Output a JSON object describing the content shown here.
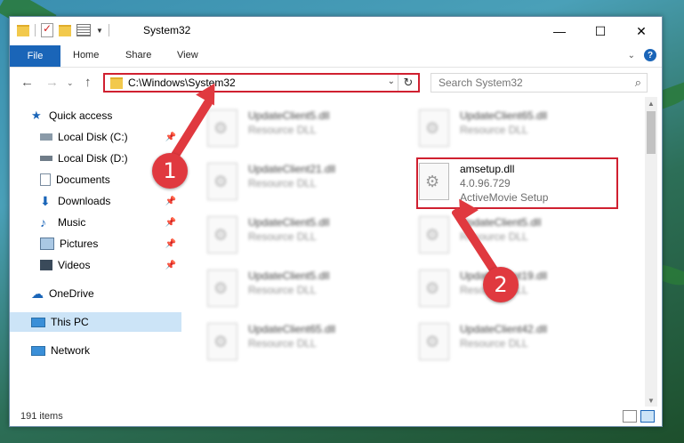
{
  "window": {
    "title": "System32",
    "controls": {
      "minimize": "—",
      "maximize": "☐",
      "close": "✕"
    }
  },
  "ribbon": {
    "file": "File",
    "tabs": [
      "Home",
      "Share",
      "View"
    ]
  },
  "address": {
    "path": "C:\\Windows\\System32",
    "search_placeholder": "Search System32"
  },
  "nav_pane": {
    "quick_access": "Quick access",
    "items": [
      {
        "label": "Local Disk (C:)",
        "icon": "drive-icon",
        "pinned": true
      },
      {
        "label": "Local Disk (D:)",
        "icon": "drive-icon",
        "pinned": false
      },
      {
        "label": "Documents",
        "icon": "documents-icon",
        "pinned": true
      },
      {
        "label": "Downloads",
        "icon": "downloads-icon",
        "pinned": true
      },
      {
        "label": "Music",
        "icon": "music-icon",
        "pinned": true
      },
      {
        "label": "Pictures",
        "icon": "pictures-icon",
        "pinned": true
      },
      {
        "label": "Videos",
        "icon": "videos-icon",
        "pinned": true
      }
    ],
    "onedrive": "OneDrive",
    "this_pc": "This PC",
    "network": "Network"
  },
  "files": [
    {
      "name": "UpdateClient5.dll",
      "type": "Resource DLL",
      "blurred": true
    },
    {
      "name": "UpdateClient65.dll",
      "type": "Resource DLL",
      "blurred": true
    },
    {
      "name": "UpdateClient21.dll",
      "type": "Resource DLL",
      "blurred": true
    },
    {
      "name": "amsetup.dll",
      "version": "4.0.96.729",
      "type": "ActiveMovie Setup",
      "blurred": false
    },
    {
      "name": "UpdateClient5.dll",
      "type": "Resource DLL",
      "blurred": true
    },
    {
      "name": "UpdateClient5.dll",
      "type": "Resource DLL",
      "blurred": true
    },
    {
      "name": "UpdateClient5.dll",
      "type": "Resource DLL",
      "blurred": true
    },
    {
      "name": "UpdateClient19.dll",
      "type": "Resource DLL",
      "blurred": true
    },
    {
      "name": "UpdateClient65.dll",
      "type": "Resource DLL",
      "blurred": true
    },
    {
      "name": "UpdateClient42.dll",
      "type": "Resource DLL",
      "blurred": true
    }
  ],
  "status": {
    "item_count": "191 items"
  },
  "callouts": {
    "one": "1",
    "two": "2"
  },
  "colors": {
    "accent": "#1a65b8",
    "callout": "#e0393f",
    "highlight": "#d02030"
  }
}
